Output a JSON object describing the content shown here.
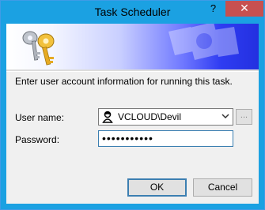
{
  "window": {
    "title": "Task Scheduler"
  },
  "titlebar": {
    "help_label": "?",
    "close_label": "✕"
  },
  "dialog": {
    "instruction": "Enter user account information for running this task.",
    "user_label": "User name:",
    "user_value": "VCLOUD\\Devil",
    "browse_label": "...",
    "password_label": "Password:",
    "password_value": "•••••••••••",
    "ok_label": "OK",
    "cancel_label": "Cancel"
  },
  "colors": {
    "titlebar": "#1ba1e2",
    "close": "#c75050",
    "focus": "#3c7fb1"
  },
  "icons": [
    "keys-icon",
    "user-icon",
    "chevron-down-icon"
  ]
}
